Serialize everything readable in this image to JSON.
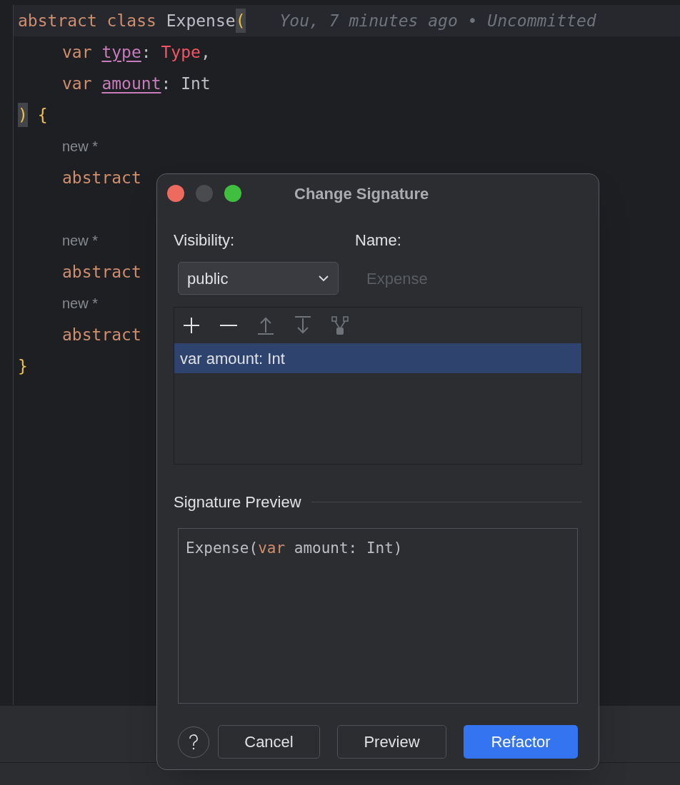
{
  "editor": {
    "lines": [
      {
        "current": true,
        "indented": false,
        "segments": [
          {
            "text": "abstract class ",
            "kind": "keyword"
          },
          {
            "text": "Expense",
            "kind": "plain"
          },
          {
            "text": "(",
            "kind": "bracket_match"
          }
        ],
        "blame": "You, 7 minutes ago • Uncommitted"
      },
      {
        "current": false,
        "indented": true,
        "segments": [
          {
            "text": "var ",
            "kind": "keyword"
          },
          {
            "text": "type",
            "kind": "property"
          },
          {
            "text": ": ",
            "kind": "plain"
          },
          {
            "text": "Type",
            "kind": "error"
          },
          {
            "text": ",",
            "kind": "plain"
          }
        ]
      },
      {
        "current": false,
        "indented": true,
        "segments": [
          {
            "text": "var ",
            "kind": "keyword"
          },
          {
            "text": "amount",
            "kind": "property"
          },
          {
            "text": ": Int",
            "kind": "plain"
          }
        ]
      },
      {
        "current": false,
        "indented": false,
        "segments": [
          {
            "text": ")",
            "kind": "bracket_match"
          },
          {
            "text": " {",
            "kind": "brace"
          }
        ]
      },
      {
        "current": false,
        "indented": true,
        "inlay": "new *"
      },
      {
        "current": false,
        "indented": true,
        "segments": [
          {
            "text": "abstract",
            "kind": "keyword"
          }
        ]
      },
      {
        "current": false
      },
      {
        "current": false,
        "indented": true,
        "inlay": "new *"
      },
      {
        "current": false,
        "indented": true,
        "segments": [
          {
            "text": "abstract",
            "kind": "keyword"
          }
        ]
      },
      {
        "current": false,
        "indented": true,
        "inlay": "new *"
      },
      {
        "current": false,
        "indented": true,
        "segments": [
          {
            "text": "abstract",
            "kind": "keyword"
          }
        ]
      },
      {
        "current": false,
        "indented": false,
        "segments": [
          {
            "text": "}",
            "kind": "brace"
          }
        ]
      }
    ]
  },
  "dialog": {
    "title": "Change Signature",
    "visibility": {
      "label": "Visibility:",
      "value": "public"
    },
    "name": {
      "label": "Name:",
      "value": "Expense",
      "disabled": true
    },
    "toolbar": [
      {
        "kind": "add",
        "disabled": false
      },
      {
        "kind": "remove",
        "disabled": false
      },
      {
        "kind": "up",
        "disabled": true
      },
      {
        "kind": "down",
        "disabled": true
      },
      {
        "kind": "propagate",
        "disabled": true
      }
    ],
    "parameters": [
      {
        "text": "var amount: Int",
        "selected": true
      }
    ],
    "preview": {
      "label": "Signature Preview",
      "segments": [
        {
          "text": "Expense(",
          "kind": "plain"
        },
        {
          "text": "var",
          "kind": "keyword"
        },
        {
          "text": " amount: Int)",
          "kind": "plain"
        }
      ]
    },
    "buttons": [
      {
        "label": "Cancel",
        "kind": "secondary"
      },
      {
        "label": "Preview",
        "kind": "secondary"
      },
      {
        "label": "Refactor",
        "kind": "primary"
      }
    ]
  }
}
